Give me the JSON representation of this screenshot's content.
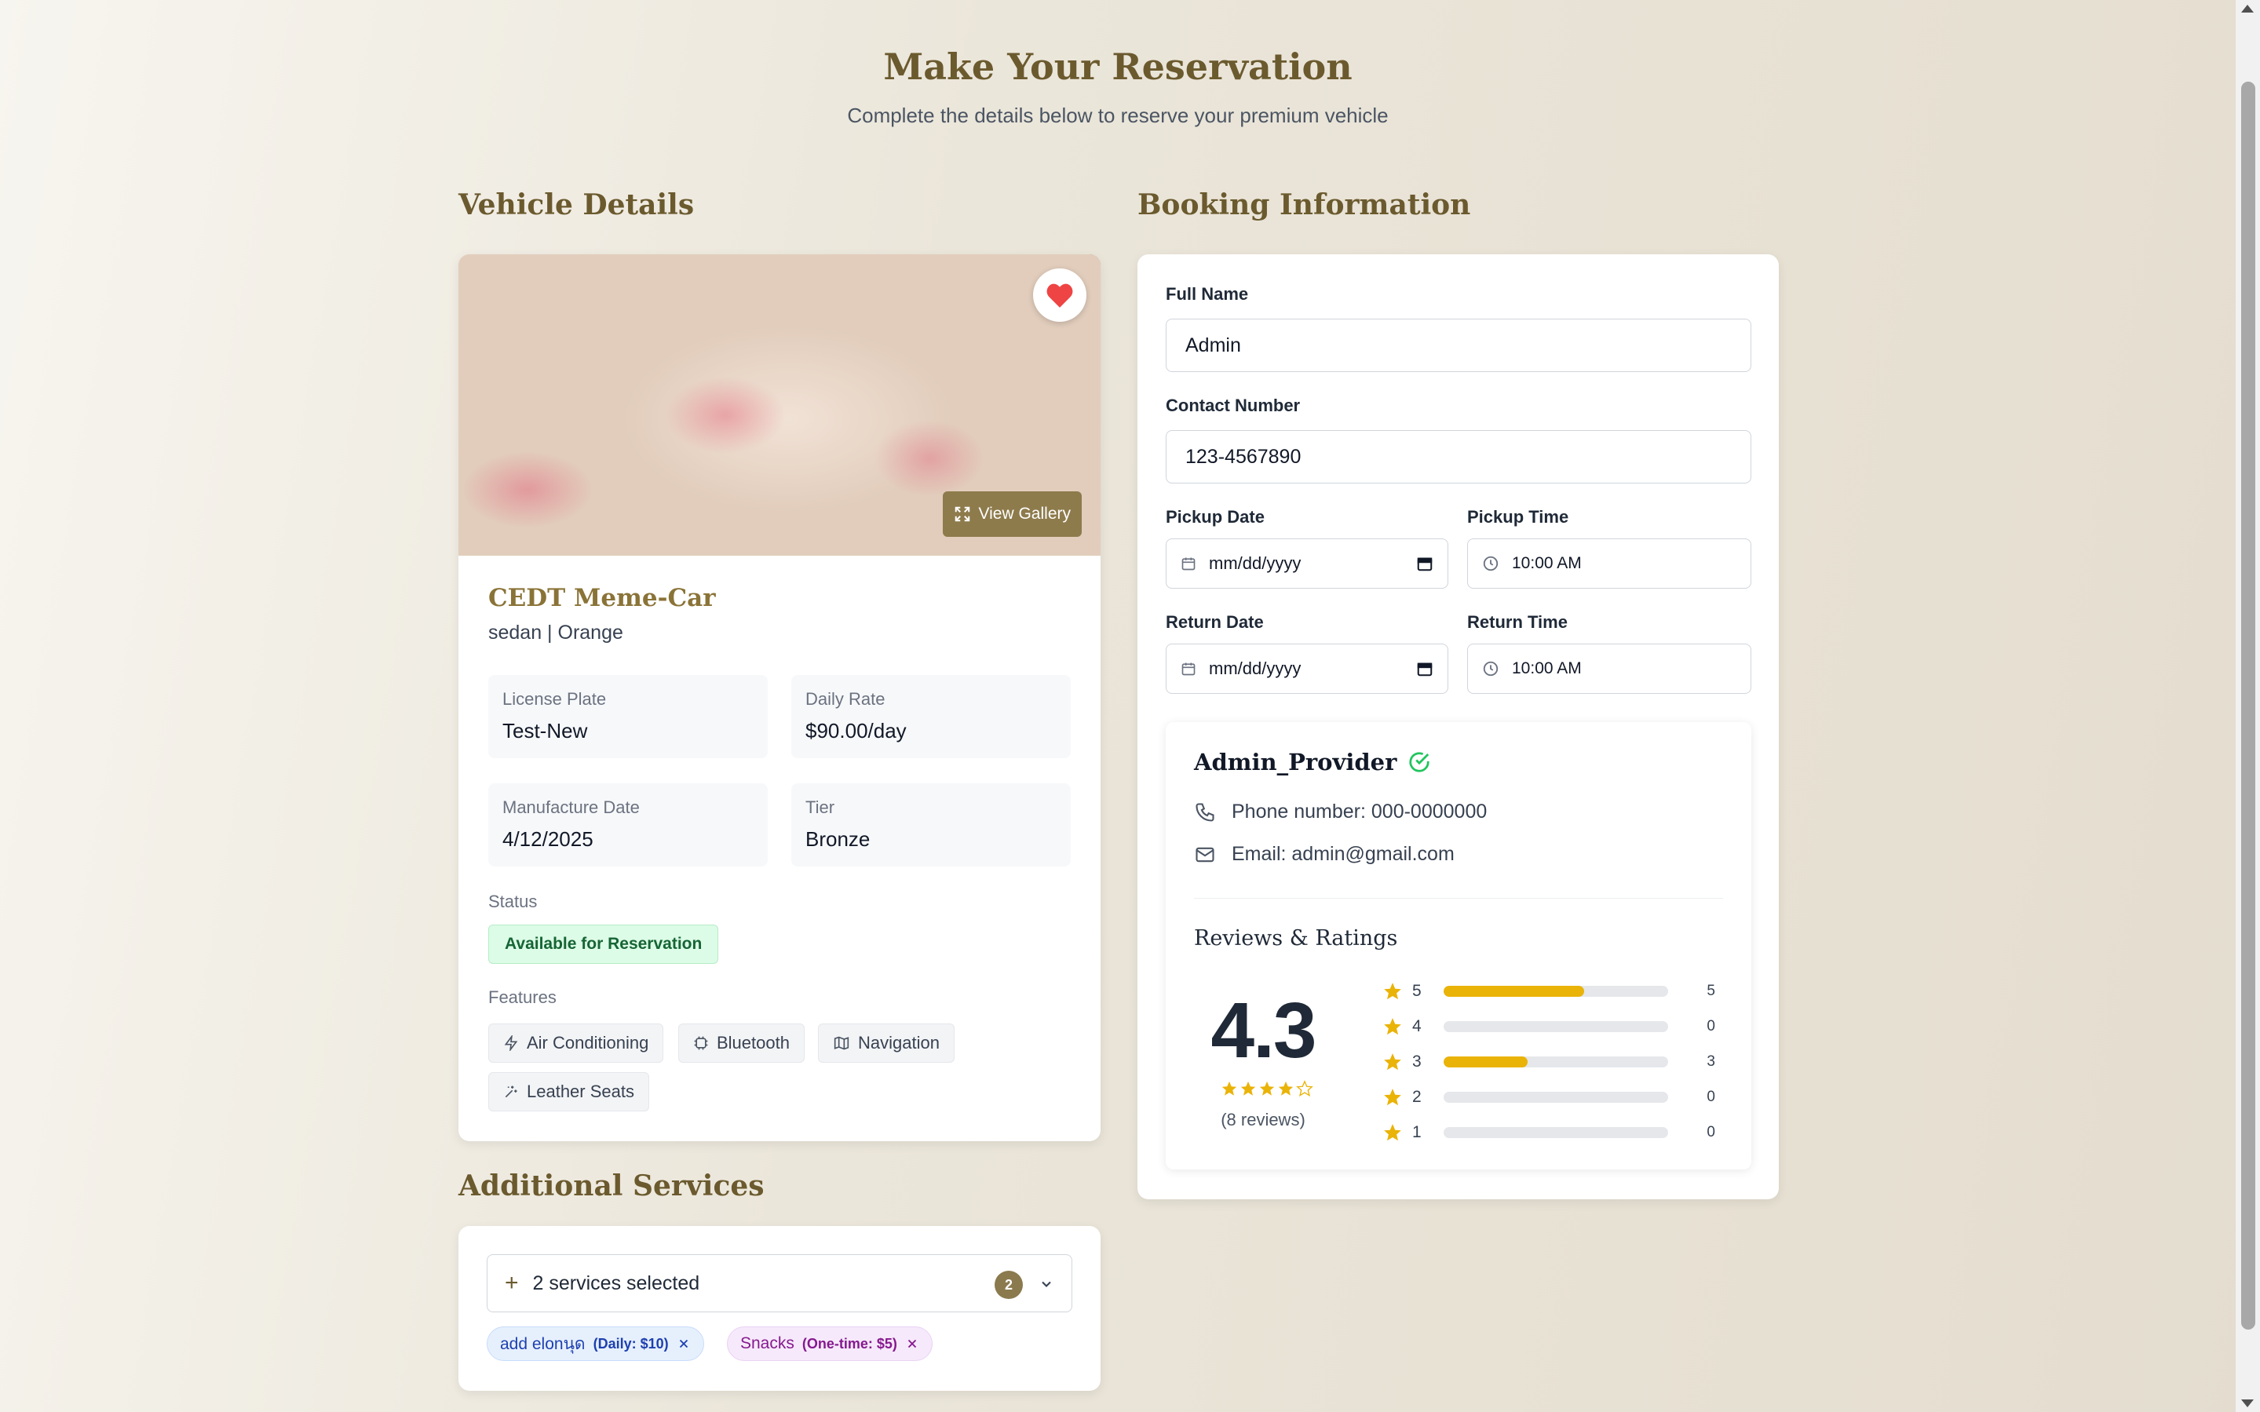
{
  "header": {
    "title": "Make Your Reservation",
    "subtitle": "Complete the details below to reserve your premium vehicle"
  },
  "vehicle_section": {
    "title": "Vehicle Details",
    "gallery_label": "View Gallery",
    "name": "CEDT Meme-Car",
    "subtitle": "sedan | Orange",
    "license_plate_label": "License Plate",
    "license_plate": "Test-New",
    "daily_rate_label": "Daily Rate",
    "daily_rate": "$90.00/day",
    "manufacture_date_label": "Manufacture Date",
    "manufacture_date": "4/12/2025",
    "tier_label": "Tier",
    "tier": "Bronze",
    "status_label": "Status",
    "status": "Available for Reservation",
    "features_label": "Features",
    "features": [
      "Air Conditioning",
      "Bluetooth",
      "Navigation",
      "Leather Seats"
    ],
    "favorite_color": "#ef4444"
  },
  "services_section": {
    "title": "Additional Services",
    "selected_text": "2 services selected",
    "count": "2",
    "chips": [
      {
        "name": "add elonนุด",
        "detail": "(Daily: $10)"
      },
      {
        "name": "Snacks",
        "detail": "(One-time: $5)"
      }
    ]
  },
  "booking_section": {
    "title": "Booking Information",
    "full_name_label": "Full Name",
    "full_name": "Admin",
    "contact_label": "Contact Number",
    "contact": "123-4567890",
    "pickup_date_label": "Pickup Date",
    "pickup_date_placeholder": "mm/dd/yyyy",
    "pickup_time_label": "Pickup Time",
    "pickup_time": "10:00 AM",
    "return_date_label": "Return Date",
    "return_date_placeholder": "mm/dd/yyyy",
    "return_time_label": "Return Time",
    "return_time": "10:00 AM"
  },
  "provider": {
    "name": "Admin_Provider",
    "phone": "Phone number: 000-0000000",
    "email": "Email: admin@gmail.com",
    "reviews_title": "Reviews & Ratings",
    "rating": "4.3",
    "stars_filled": 4,
    "review_count": "(8 reviews)",
    "distribution": [
      {
        "stars": "5",
        "count": "5",
        "fraction": 0.625
      },
      {
        "stars": "4",
        "count": "0",
        "fraction": 0
      },
      {
        "stars": "3",
        "count": "3",
        "fraction": 0.375
      },
      {
        "stars": "2",
        "count": "0",
        "fraction": 0
      },
      {
        "stars": "1",
        "count": "0",
        "fraction": 0
      }
    ],
    "accent_color": "#eab308",
    "verified_color": "#22c55e"
  }
}
